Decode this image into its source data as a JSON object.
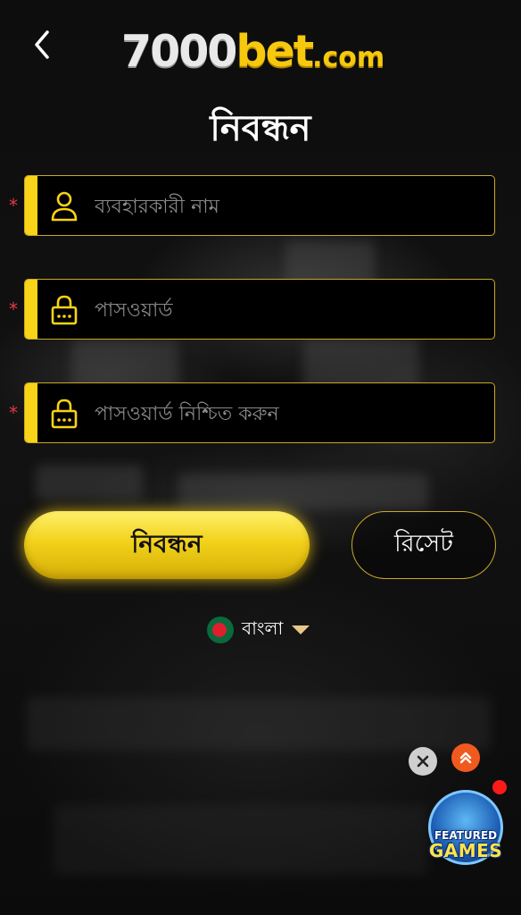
{
  "header": {
    "logo_number": "7000",
    "logo_bet": "bet",
    "logo_domain": ".com"
  },
  "page_title": "নিবন্ধন",
  "form": {
    "username_placeholder": "ব্যবহারকারী নাম",
    "password_placeholder": "পাসওয়ার্ড",
    "confirm_password_placeholder": "পাসওয়ার্ড নিশ্চিত করুন",
    "required_mark": "*"
  },
  "buttons": {
    "register_label": "নিবন্ধন",
    "reset_label": "রিসেট"
  },
  "language": {
    "selected": "বাংলা",
    "flag": "bangladesh-flag-icon"
  },
  "floating": {
    "close_icon": "close-icon",
    "scroll_up_icon": "double-chevron-up-icon",
    "promo_line1": "FEATURED",
    "promo_line2": "GAMES"
  },
  "colors": {
    "accent": "#f8d317",
    "required": "#e4374a",
    "background": "#0c0c0c"
  }
}
